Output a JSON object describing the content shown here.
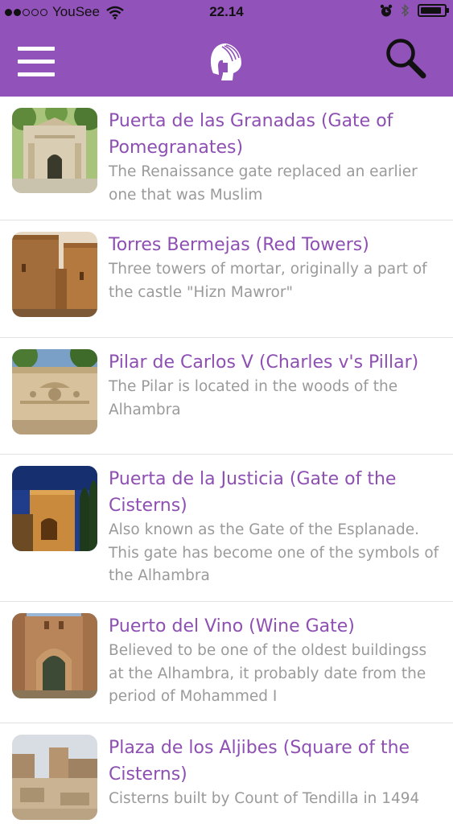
{
  "status_bar": {
    "carrier": "YouSee",
    "time": "22.14",
    "signal_bars_filled": 2,
    "signal_bars_total": 5,
    "battery_level": 0.9
  },
  "app_bar": {
    "menu_icon": "hamburger-menu-icon",
    "logo_icon": "spartan-helmet-icon",
    "search_icon": "magnifier-icon",
    "color": "#9152b9"
  },
  "items": [
    {
      "title": "Puerta de las Granadas (Gate of Pomegranates)",
      "desc": "The Renaissance gate replaced an earlier one that was Muslim"
    },
    {
      "title": "Torres Bermejas (Red Towers)",
      "desc": "Three towers of mortar, originally a part of the castle \"Hizn Mawror\""
    },
    {
      "title": "Pilar de Carlos V (Charles v's Pillar)",
      "desc": "The Pilar is located in the woods of the Alhambra"
    },
    {
      "title": "Puerta de la Justicia (Gate of the Cisterns)",
      "desc": "Also known as the Gate of the Esplanade. This gate has become one of the symbols of the Alhambra"
    },
    {
      "title": "Puerto del Vino (Wine Gate)",
      "desc": "Believed to be one of the oldest buildingss at the Alhambra, it probably date from the period of Mohammed I"
    },
    {
      "title": "Plaza de los Aljibes (Square of the Cisterns)",
      "desc": "Cisterns built by Count of Tendilla in 1494"
    }
  ]
}
